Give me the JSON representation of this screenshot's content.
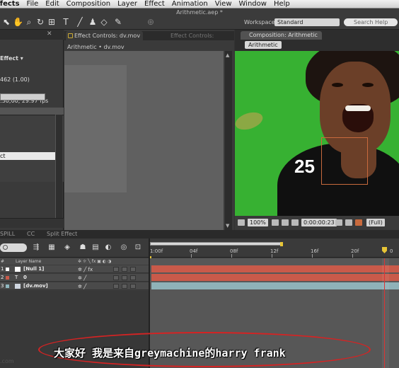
{
  "menu": {
    "items": [
      "ffects",
      "File",
      "Edit",
      "Composition",
      "Layer",
      "Effect",
      "Animation",
      "View",
      "Window",
      "Help"
    ]
  },
  "app": {
    "title": "Arithmetic.aep *"
  },
  "toolbar": {
    "workspace_label": "Workspace:",
    "workspace_value": "Standard",
    "search_placeholder": "Search Help"
  },
  "project": {
    "title_line": "Effect ▾",
    "info_line1": "462 (1.00)",
    "info_line2": ":30;00, 29.97 fps",
    "selected_item": "ct"
  },
  "effect_controls": {
    "tab_label": "Effect Controls: dv.mov",
    "tab2_label": "Effect Controls:",
    "breadcrumb": "Arithmetic • dv.mov"
  },
  "composition": {
    "tab_label": "Composition: Arithmetic",
    "crumb": "Arithmetic",
    "overlay_number": "25",
    "zoom": "100%",
    "timecode": "0:00:00:23",
    "quality": "(Full)"
  },
  "lower_tabs": [
    "SPILL",
    "CC",
    "Split Effect"
  ],
  "timeline": {
    "ruler_labels": [
      "1:00f",
      "04f",
      "08f",
      "12f",
      "16f",
      "20f",
      "0"
    ],
    "header": {
      "number": "#",
      "layer_name": "Layer Name"
    },
    "layers": [
      {
        "num": "1",
        "name": "[Null 1]",
        "chip": "#ffffff",
        "track_color": "#c95a4a"
      },
      {
        "num": "2",
        "name": "0",
        "chip": "#c95a4a",
        "track_color": "#c95a4a"
      },
      {
        "num": "3",
        "name": "[dv.mov]",
        "chip": "#8fb7bf",
        "track_color": "#8fb2b8"
      }
    ],
    "playhead_color": "#e7c536"
  },
  "subtitle": {
    "text": "大家好 我是来自greymachine的harry frank",
    "ellipse_color": "#d52323"
  },
  "watermark": ".com"
}
